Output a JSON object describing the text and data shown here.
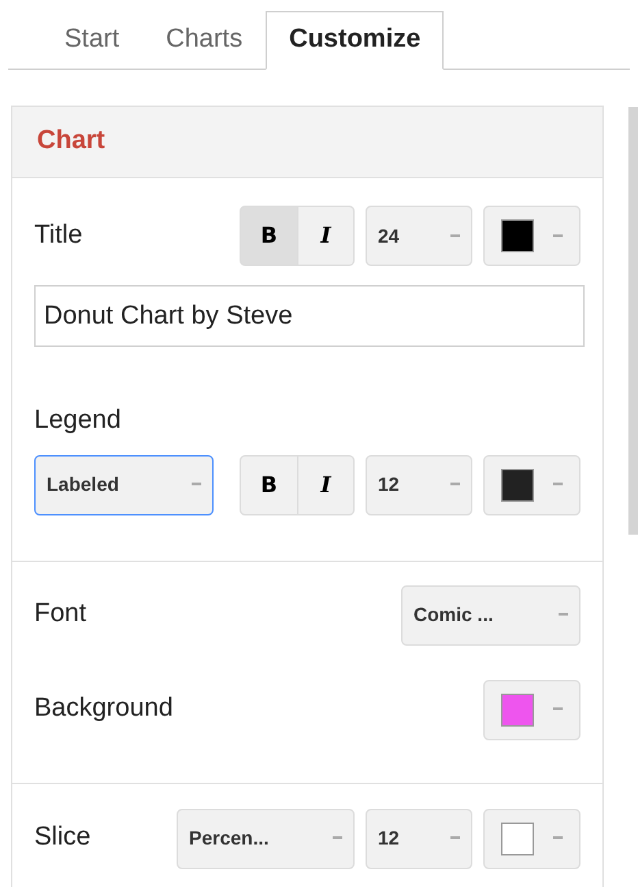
{
  "tabs": [
    {
      "label": "Start",
      "selected": false
    },
    {
      "label": "Charts",
      "selected": false
    },
    {
      "label": "Customize",
      "selected": true
    }
  ],
  "section": {
    "title": "Chart"
  },
  "title": {
    "label": "Title",
    "bold": {
      "label": "B",
      "selected": true
    },
    "italic": {
      "label": "I",
      "selected": false
    },
    "size": "24",
    "color": "#000000",
    "value": "Donut Chart by Steve"
  },
  "legend": {
    "label": "Legend",
    "position": "Labeled",
    "bold": {
      "label": "B",
      "selected": false
    },
    "italic": {
      "label": "I",
      "selected": false
    },
    "size": "12",
    "color": "#222222"
  },
  "font": {
    "label": "Font",
    "value": "Comic ..."
  },
  "background": {
    "label": "Background",
    "color": "#ee55ee"
  },
  "slice": {
    "label": "Slice",
    "value": "Percen...",
    "size": "12",
    "color": "#ffffff"
  }
}
